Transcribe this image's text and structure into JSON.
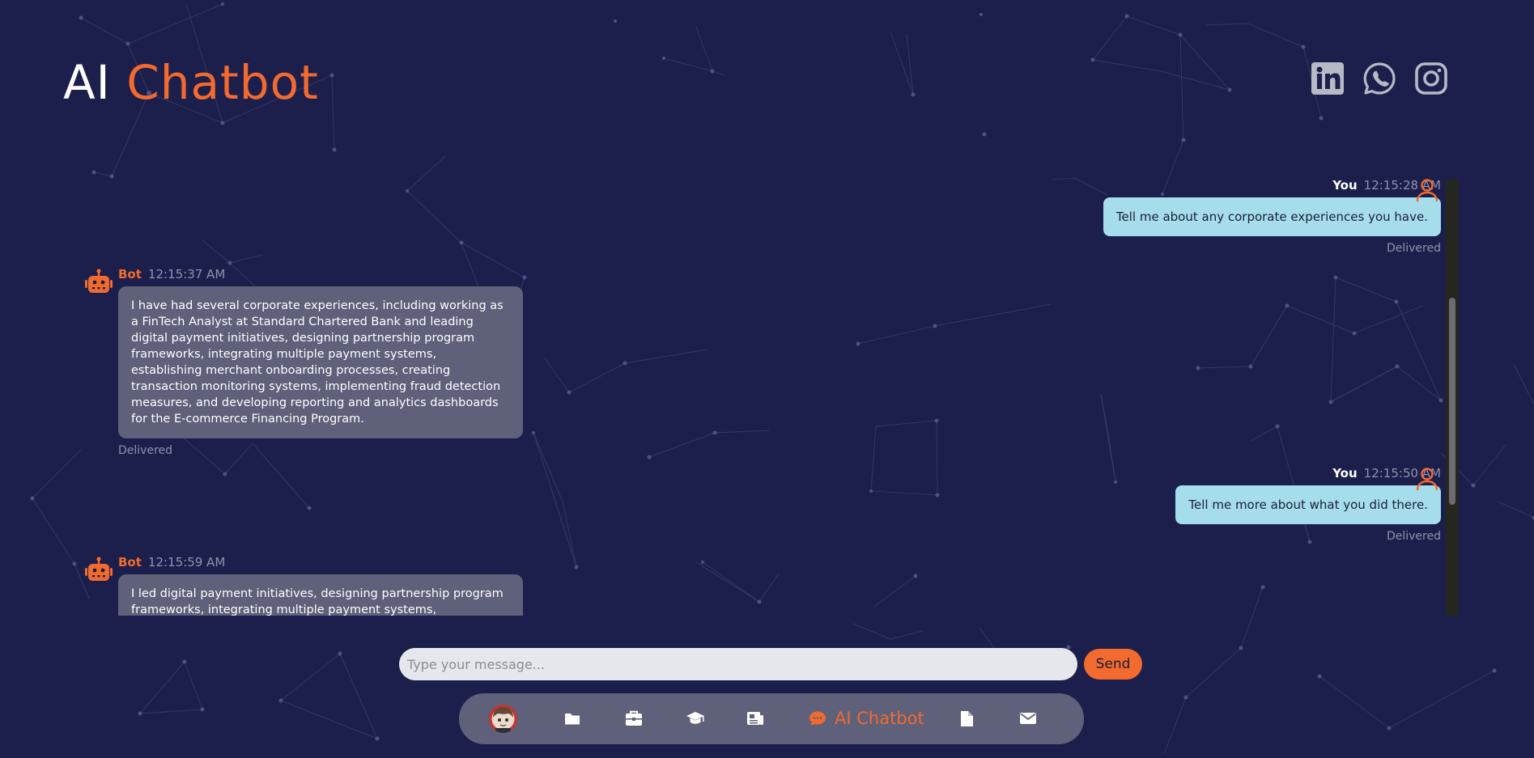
{
  "header": {
    "title_main": "AI",
    "title_accent": "Chatbot"
  },
  "social": [
    {
      "icon": "linkedin-icon"
    },
    {
      "icon": "whatsapp-icon"
    },
    {
      "icon": "instagram-icon"
    }
  ],
  "colors": {
    "background": "#1c1f4b",
    "accent": "#f26a2e",
    "bot_bubble": "#5f6079",
    "user_bubble": "#a5ddeb",
    "nav_bar": "#5f6079"
  },
  "messages": [
    {
      "sender": "You",
      "time": "12:15:28 AM",
      "text": "Tell me about any corporate experiences you have.",
      "status": "Delivered"
    },
    {
      "sender": "Bot",
      "time": "12:15:37 AM",
      "text": "I have had several corporate experiences, including working as a FinTech Analyst at Standard Chartered Bank and leading digital payment initiatives, designing partnership program frameworks, integrating multiple payment systems, establishing merchant onboarding processes, creating transaction monitoring systems, implementing fraud detection measures, and developing reporting and analytics dashboards for the E-commerce Financing Program.",
      "status": "Delivered"
    },
    {
      "sender": "You",
      "time": "12:15:50 AM",
      "text": "Tell me more about what you did there.",
      "status": "Delivered"
    },
    {
      "sender": "Bot",
      "time": "12:15:59 AM",
      "text": "I led digital payment initiatives, designing partnership program frameworks, integrating multiple payment systems, establishing"
    }
  ],
  "composer": {
    "placeholder": "Type your message...",
    "send_label": "Send"
  },
  "nav": {
    "items": [
      {
        "icon": "avatar-photo"
      },
      {
        "icon": "folder-icon"
      },
      {
        "icon": "briefcase-icon"
      },
      {
        "icon": "graduation-cap-icon"
      },
      {
        "icon": "newspaper-icon"
      },
      {
        "icon": "chat-icon",
        "label": "AI Chatbot",
        "active": true
      },
      {
        "icon": "file-icon"
      },
      {
        "icon": "envelope-icon"
      }
    ]
  }
}
